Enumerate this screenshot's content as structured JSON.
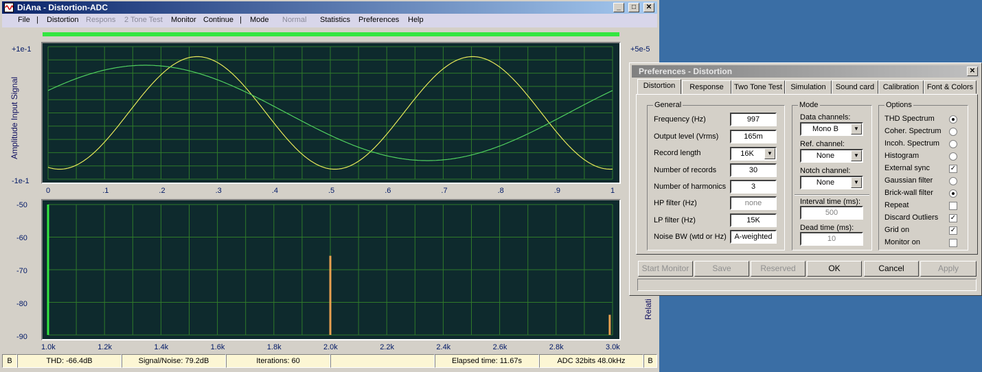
{
  "window": {
    "title": "DiAna - Distortion-ADC",
    "min": "_",
    "max": "□",
    "close": "✕"
  },
  "menu": [
    {
      "label": "File",
      "disabled": false
    },
    {
      "label": "|",
      "disabled": false
    },
    {
      "label": "Distortion",
      "disabled": false
    },
    {
      "label": "Respons",
      "disabled": true
    },
    {
      "label": "2 Tone Test",
      "disabled": true
    },
    {
      "label": "Monitor",
      "disabled": false
    },
    {
      "label": "Continue",
      "disabled": false
    },
    {
      "label": "|",
      "disabled": false
    },
    {
      "label": "Mode",
      "disabled": false
    },
    {
      "label": "Normal",
      "disabled": true
    },
    {
      "label": "Statistics",
      "disabled": false
    },
    {
      "label": "Preferences",
      "disabled": false
    },
    {
      "label": "Help",
      "disabled": false
    }
  ],
  "chart_data": [
    {
      "type": "line",
      "ylabel": "Amplitude Input Signal",
      "x_ticks": [
        "0",
        ".1",
        ".2",
        ".3",
        ".4",
        ".5",
        ".6",
        ".7",
        ".8",
        ".9",
        "1"
      ],
      "y_top_label": "+1e-1",
      "y_bottom_label": "-1e-1",
      "y_right_top_label": "+5e-5",
      "xlim": [
        0,
        1
      ],
      "ylim": [
        -1,
        1
      ],
      "grid": true,
      "series": [
        {
          "color": "#e8e85a",
          "type": "sine",
          "amplitude": 0.85,
          "periods": 2.05,
          "phase_deg": -105
        },
        {
          "color": "#50d060",
          "type": "sine",
          "amplitude": 0.72,
          "periods": 1.0,
          "phase_deg": 28
        }
      ]
    },
    {
      "type": "bar",
      "x_ticks": [
        "1.0k",
        "1.2k",
        "1.4k",
        "1.6k",
        "1.8k",
        "2.0k",
        "2.2k",
        "2.4k",
        "2.6k",
        "2.8k",
        "3.0k"
      ],
      "y_ticks": [
        "-50",
        "-60",
        "-70",
        "-80",
        "-90"
      ],
      "ylabel_right": "Relati",
      "xlim": [
        1000,
        3000
      ],
      "ylim": [
        -92,
        -50
      ],
      "grid": true,
      "bars": [
        {
          "x": 1000,
          "y": -50,
          "color": "#33e640"
        },
        {
          "x": 2000,
          "y": -66.5,
          "color": "#e8a050"
        },
        {
          "x": 2990,
          "y": -85.5,
          "color": "#e8a050"
        }
      ]
    }
  ],
  "status": {
    "left_b": "B",
    "thd": "THD:  -66.4dB",
    "snr": "Signal/Noise:   79.2dB",
    "iterations": "Iterations: 60",
    "blank": "",
    "elapsed": "Elapsed time: 11.67s",
    "adc": "ADC 32bits 48.0kHz",
    "right_b": "B"
  },
  "dialog": {
    "title": "Preferences - Distortion",
    "close": "✕",
    "tabs": [
      "Distortion",
      "Response",
      "Two Tone Test",
      "Simulation",
      "Sound card",
      "Calibration",
      "Font & Colors"
    ],
    "general": {
      "title": "General",
      "fields": [
        {
          "label": "Frequency (Hz)",
          "value": "997",
          "type": "text",
          "dim": false
        },
        {
          "label": "Output level (Vrms)",
          "value": "165m",
          "type": "text",
          "dim": false
        },
        {
          "label": "Record length",
          "value": "16K",
          "type": "combo",
          "dim": false
        },
        {
          "label": "Number of records",
          "value": "30",
          "type": "text",
          "dim": false
        },
        {
          "label": "Number of harmonics",
          "value": "3",
          "type": "text",
          "dim": false
        },
        {
          "label": "HP filter (Hz)",
          "value": "none",
          "type": "text",
          "dim": true
        },
        {
          "label": "LP filter (Hz)",
          "value": "15K",
          "type": "text",
          "dim": false
        },
        {
          "label": "Noise BW (wtd or Hz)",
          "value": "A-weighted",
          "type": "text",
          "dim": false
        }
      ]
    },
    "mode": {
      "title": "Mode",
      "data_channels_label": "Data channels:",
      "data_channels_value": "Mono  B",
      "ref_channel_label": "Ref. channel:",
      "ref_channel_value": "None",
      "notch_channel_label": "Notch channel:",
      "notch_channel_value": "None",
      "interval_label": "Interval time (ms):",
      "interval_value": "500",
      "dead_label": "Dead time (ms):",
      "dead_value": "10"
    },
    "options": {
      "title": "Options",
      "items": [
        {
          "label": "THD Spectrum",
          "kind": "radio",
          "checked": true
        },
        {
          "label": "Coher. Spectrum",
          "kind": "radio",
          "checked": false
        },
        {
          "label": "Incoh. Spectrum",
          "kind": "radio",
          "checked": false
        },
        {
          "label": "Histogram",
          "kind": "radio",
          "checked": false
        },
        {
          "label": "External sync",
          "kind": "check",
          "checked": true
        },
        {
          "label": "Gaussian filter",
          "kind": "radio",
          "checked": false
        },
        {
          "label": "Brick-wall filter",
          "kind": "radio",
          "checked": true
        },
        {
          "label": "Repeat",
          "kind": "check",
          "checked": false
        },
        {
          "label": "Discard Outliers",
          "kind": "check",
          "checked": true
        },
        {
          "label": "Grid on",
          "kind": "check",
          "checked": true
        },
        {
          "label": "Monitor on",
          "kind": "check",
          "checked": false
        }
      ]
    },
    "buttons": [
      {
        "label": "Start  Monitor",
        "disabled": true
      },
      {
        "label": "Save",
        "disabled": true
      },
      {
        "label": "Reserved",
        "disabled": true
      },
      {
        "label": "OK",
        "disabled": false
      },
      {
        "label": "Cancel",
        "disabled": false
      },
      {
        "label": "Apply",
        "disabled": true
      }
    ]
  }
}
